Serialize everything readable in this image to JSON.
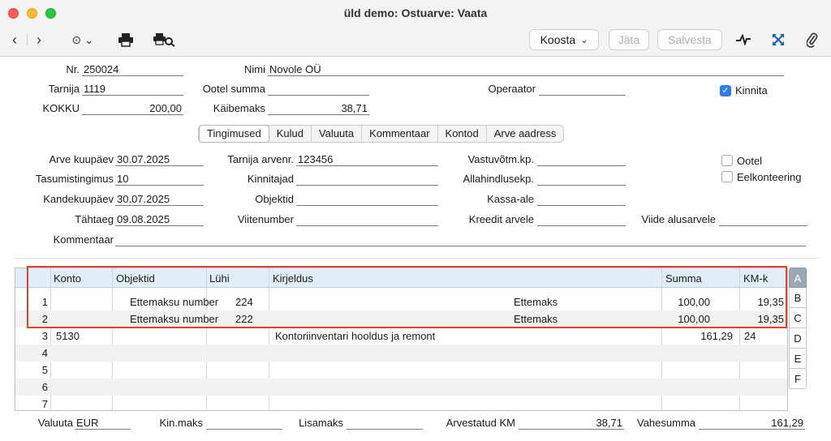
{
  "window": {
    "title": "üld demo: Ostuarve: Vaata"
  },
  "toolbar": {
    "koosta_label": "Koosta",
    "jata_label": "Jäta",
    "salvesta_label": "Salvesta"
  },
  "header": {
    "nr_label": "Nr.",
    "nr_value": "250024",
    "nimi_label": "Nimi",
    "nimi_value": "Novole OÜ",
    "tarnija_label": "Tarnija",
    "tarnija_value": "1119",
    "ootel_summa_label": "Ootel summa",
    "ootel_summa_value": "",
    "operaator_label": "Operaator",
    "operaator_value": "",
    "kinnita_label": "Kinnita",
    "kinnita_checked": true,
    "kokku_label": "KOKKU",
    "kokku_value": "200,00",
    "kaibemaks_label": "Käibemaks",
    "kaibemaks_value": "38,71"
  },
  "tabs": [
    "Tingimused",
    "Kulud",
    "Valuuta",
    "Kommentaar",
    "Kontod",
    "Arve aadress"
  ],
  "terms": {
    "arve_kuupaev_label": "Arve kuupäev",
    "arve_kuupaev_value": "30.07.2025",
    "tarnija_arvenr_label": "Tarnija arvenr.",
    "tarnija_arvenr_value": "123456",
    "vastuvotm_label": "Vastuvõtm.kp.",
    "vastuvotm_value": "",
    "ootel_label": "Ootel",
    "tasumistingimus_label": "Tasumistingimus",
    "tasumistingimus_value": "10",
    "kinnitajad_label": "Kinnitajad",
    "kinnitajad_value": "",
    "allahindlusekp_label": "Allahindlusekp.",
    "allahindlusekp_value": "",
    "eelkonteering_label": "Eelkonteering",
    "kandekuupaev_label": "Kandekuupäev",
    "kandekuupaev_value": "30.07.2025",
    "objektid_label": "Objektid",
    "objektid_value": "",
    "kassa_ale_label": "Kassa-ale",
    "kassa_ale_value": "",
    "tahtaeg_label": "Tähtaeg",
    "tahtaeg_value": "09.08.2025",
    "viitenumber_label": "Viitenumber",
    "viitenumber_value": "",
    "kreedit_arvele_label": "Kreedit arvele",
    "kreedit_arvele_value": "",
    "viide_alusarvele_label": "Viide alusarvele",
    "viide_alusarvele_value": "",
    "kommentaar_label": "Kommentaar",
    "kommentaar_value": ""
  },
  "grid": {
    "columns": [
      "Konto",
      "Objektid",
      "Lühi",
      "Kirjeldus",
      "Summa",
      "KM-k"
    ],
    "rows": [
      {
        "n": "1",
        "konto": "",
        "objektid": "Ettemaksu number",
        "luhi": "224",
        "kirjeldus": "",
        "extra": "Ettemaks",
        "summa": "100,00",
        "kmk": "19,35"
      },
      {
        "n": "2",
        "konto": "",
        "objektid": "Ettemaksu number",
        "luhi": "222",
        "kirjeldus": "",
        "extra": "Ettemaks",
        "summa": "100,00",
        "kmk": "19,35"
      },
      {
        "n": "3",
        "konto": "5130",
        "objektid": "",
        "luhi": "",
        "kirjeldus": "Kontoriinventari hooldus ja remont",
        "extra": "",
        "summa": "161,29",
        "kmk": "24"
      },
      {
        "n": "4",
        "konto": "",
        "objektid": "",
        "luhi": "",
        "kirjeldus": "",
        "extra": "",
        "summa": "",
        "kmk": ""
      },
      {
        "n": "5",
        "konto": "",
        "objektid": "",
        "luhi": "",
        "kirjeldus": "",
        "extra": "",
        "summa": "",
        "kmk": ""
      },
      {
        "n": "6",
        "konto": "",
        "objektid": "",
        "luhi": "",
        "kirjeldus": "",
        "extra": "",
        "summa": "",
        "kmk": ""
      },
      {
        "n": "7",
        "konto": "",
        "objektid": "",
        "luhi": "",
        "kirjeldus": "",
        "extra": "",
        "summa": "",
        "kmk": ""
      }
    ],
    "side_tabs": [
      "A",
      "B",
      "C",
      "D",
      "E",
      "F"
    ]
  },
  "footer": {
    "valuuta_label": "Valuuta",
    "valuuta_value": "EUR",
    "kinmaks_label": "Kin.maks",
    "kinmaks_value": "",
    "lisamaks_label": "Lisamaks",
    "lisamaks_value": "",
    "arvestatud_km_label": "Arvestatud KM",
    "arvestatud_km_value": "38,71",
    "vahesumma_label": "Vahesumma",
    "vahesumma_value": "161,29"
  }
}
